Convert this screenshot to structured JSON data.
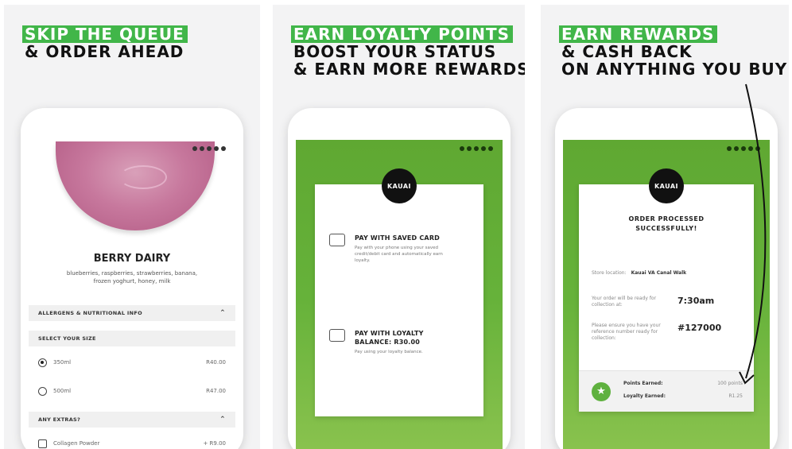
{
  "panel1": {
    "headline_highlight": "SKIP THE QUEUE",
    "headline_rest": "& ORDER AHEAD",
    "product": {
      "name": "BERRY DAIRY",
      "description": "blueberries, raspberries, strawberries, banana, frozen yoghurt, honey, milk"
    },
    "allergens_label": "ALLERGENS & NUTRITIONAL INFO",
    "size_label": "SELECT YOUR SIZE",
    "sizes": [
      {
        "label": "350ml",
        "price": "R40.00",
        "selected": true
      },
      {
        "label": "500ml",
        "price": "R47.00",
        "selected": false
      }
    ],
    "extras_label": "ANY EXTRAS?",
    "extras": [
      {
        "label": "Collagen Powder",
        "price": "+ R9.00"
      }
    ]
  },
  "panel2": {
    "headline_highlight": "EARN LOYALTY POINTS",
    "headline_line2": "BOOST YOUR STATUS",
    "headline_line3": "& EARN MORE REWARDS",
    "logo": "KAUAI",
    "pay_saved_title": "PAY WITH SAVED CARD",
    "pay_saved_desc": "Pay with your phone using your saved credit/debit card and automatically earn loyalty.",
    "pay_loyalty_title": "PAY WITH LOYALTY BALANCE: R30.00",
    "pay_loyalty_desc": "Pay using your loyalty balance."
  },
  "panel3": {
    "headline_highlight": "EARN REWARDS",
    "headline_line2": "& CASH BACK",
    "headline_line3": "ON ANYTHING YOU BUY",
    "logo": "KAUAI",
    "order_title": "ORDER PROCESSED SUCCESSFULLY!",
    "store_label": "Store location:",
    "store_value": "Kauai VA Canal Walk",
    "ready_label": "Your order will be ready for collection at:",
    "ready_time": "7:30am",
    "ref_label": "Please ensure you have your reference number ready for collection:",
    "ref_number": "#127000",
    "points_label": "Points Earned:",
    "points_value": "100 points",
    "loyalty_label": "Loyalty Earned:",
    "loyalty_value": "R1.25"
  },
  "colors": {
    "accent_green": "#41b649",
    "screen_green": "#66b23a"
  }
}
